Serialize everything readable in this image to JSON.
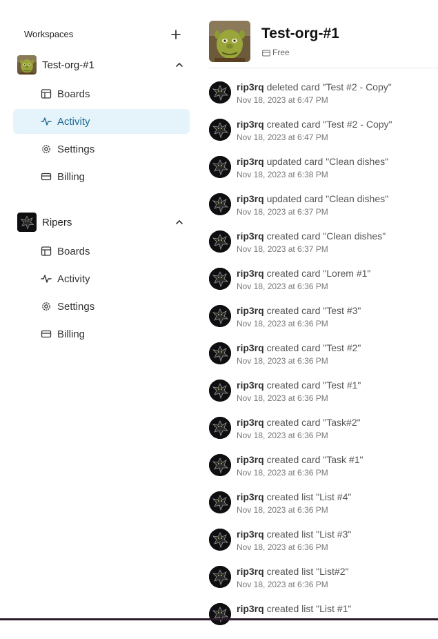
{
  "sidebar": {
    "title": "Workspaces",
    "orgs": [
      {
        "name": "Test-org-#1",
        "items": [
          {
            "label": "Boards",
            "icon": "boards-icon"
          },
          {
            "label": "Activity",
            "icon": "activity-icon"
          },
          {
            "label": "Settings",
            "icon": "settings-icon"
          },
          {
            "label": "Billing",
            "icon": "billing-icon"
          }
        ]
      },
      {
        "name": "Ripers",
        "items": [
          {
            "label": "Boards",
            "icon": "boards-icon"
          },
          {
            "label": "Activity",
            "icon": "activity-icon"
          },
          {
            "label": "Settings",
            "icon": "settings-icon"
          },
          {
            "label": "Billing",
            "icon": "billing-icon"
          }
        ]
      }
    ]
  },
  "header": {
    "title": "Test-org-#1",
    "plan": "Free"
  },
  "activity": [
    {
      "user": "rip3rq",
      "action": "deleted card \"Test #2 - Copy\"",
      "time": "Nov 18, 2023 at 6:47 PM"
    },
    {
      "user": "rip3rq",
      "action": "created card \"Test #2 - Copy\"",
      "time": "Nov 18, 2023 at 6:47 PM"
    },
    {
      "user": "rip3rq",
      "action": "updated card \"Clean dishes\"",
      "time": "Nov 18, 2023 at 6:38 PM"
    },
    {
      "user": "rip3rq",
      "action": "updated card \"Clean dishes\"",
      "time": "Nov 18, 2023 at 6:37 PM"
    },
    {
      "user": "rip3rq",
      "action": "created card \"Clean dishes\"",
      "time": "Nov 18, 2023 at 6:37 PM"
    },
    {
      "user": "rip3rq",
      "action": "created card \"Lorem #1\"",
      "time": "Nov 18, 2023 at 6:36 PM"
    },
    {
      "user": "rip3rq",
      "action": "created card \"Test #3\"",
      "time": "Nov 18, 2023 at 6:36 PM"
    },
    {
      "user": "rip3rq",
      "action": "created card \"Test #2\"",
      "time": "Nov 18, 2023 at 6:36 PM"
    },
    {
      "user": "rip3rq",
      "action": "created card \"Test #1\"",
      "time": "Nov 18, 2023 at 6:36 PM"
    },
    {
      "user": "rip3rq",
      "action": "created card \"Task#2\"",
      "time": "Nov 18, 2023 at 6:36 PM"
    },
    {
      "user": "rip3rq",
      "action": "created card \"Task #1\"",
      "time": "Nov 18, 2023 at 6:36 PM"
    },
    {
      "user": "rip3rq",
      "action": "created list \"List #4\"",
      "time": "Nov 18, 2023 at 6:36 PM"
    },
    {
      "user": "rip3rq",
      "action": "created list \"List #3\"",
      "time": "Nov 18, 2023 at 6:36 PM"
    },
    {
      "user": "rip3rq",
      "action": "created list \"List#2\"",
      "time": "Nov 18, 2023 at 6:36 PM"
    },
    {
      "user": "rip3rq",
      "action": "created list \"List #1\"",
      "time": ""
    }
  ],
  "colors": {
    "active_bg": "#e5f3fb",
    "active_text": "#1b6a92"
  }
}
